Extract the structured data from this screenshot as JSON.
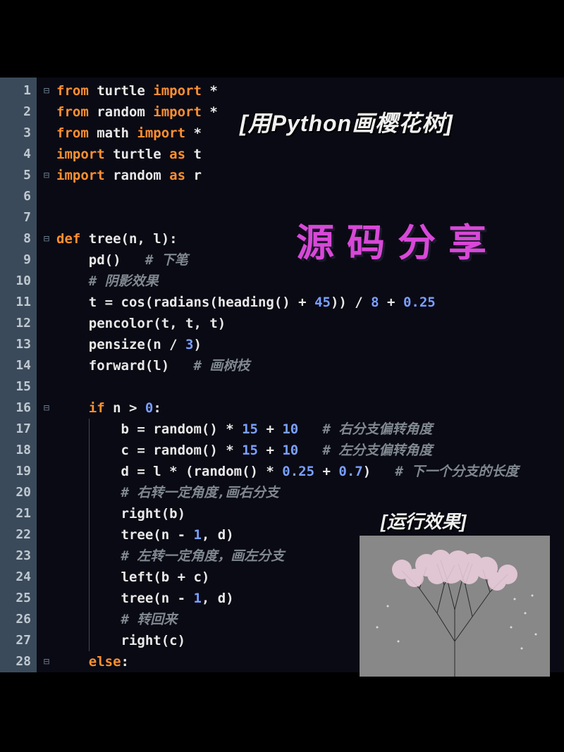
{
  "overlays": {
    "title": "[用Python画樱花树]",
    "subtitle": "源码分享",
    "result_label": "[运行效果]"
  },
  "code": {
    "lines": [
      {
        "n": 1,
        "fold": "⊟",
        "tokens": [
          [
            "kw",
            "from"
          ],
          [
            "id",
            " turtle "
          ],
          [
            "kw",
            "import"
          ],
          [
            "op",
            " *"
          ]
        ]
      },
      {
        "n": 2,
        "fold": "",
        "tokens": [
          [
            "kw",
            "from"
          ],
          [
            "id",
            " random "
          ],
          [
            "kw",
            "import"
          ],
          [
            "op",
            " *"
          ]
        ]
      },
      {
        "n": 3,
        "fold": "",
        "tokens": [
          [
            "kw",
            "from"
          ],
          [
            "id",
            " math "
          ],
          [
            "kw",
            "import"
          ],
          [
            "op",
            " *"
          ]
        ]
      },
      {
        "n": 4,
        "fold": "",
        "tokens": [
          [
            "kw",
            "import"
          ],
          [
            "id",
            " turtle "
          ],
          [
            "kw",
            "as"
          ],
          [
            "id",
            " t"
          ]
        ]
      },
      {
        "n": 5,
        "fold": "⊟",
        "tokens": [
          [
            "kw",
            "import"
          ],
          [
            "id",
            " random "
          ],
          [
            "kw",
            "as"
          ],
          [
            "id",
            " r"
          ]
        ]
      },
      {
        "n": 6,
        "fold": "",
        "tokens": []
      },
      {
        "n": 7,
        "fold": "",
        "tokens": []
      },
      {
        "n": 8,
        "fold": "⊟",
        "tokens": [
          [
            "kw",
            "def"
          ],
          [
            "id",
            " tree(n, l):"
          ]
        ]
      },
      {
        "n": 9,
        "fold": "",
        "indent": 1,
        "tokens": [
          [
            "id",
            "pd()   "
          ],
          [
            "cm",
            "# 下笔"
          ]
        ]
      },
      {
        "n": 10,
        "fold": "",
        "indent": 1,
        "tokens": [
          [
            "cm",
            "# 阴影效果"
          ]
        ]
      },
      {
        "n": 11,
        "fold": "",
        "indent": 1,
        "tokens": [
          [
            "id",
            "t = cos(radians(heading() + "
          ],
          [
            "num",
            "45"
          ],
          [
            "id",
            ")) / "
          ],
          [
            "num",
            "8"
          ],
          [
            "id",
            " + "
          ],
          [
            "num",
            "0.25"
          ]
        ]
      },
      {
        "n": 12,
        "fold": "",
        "indent": 1,
        "tokens": [
          [
            "id",
            "pencolor(t, t, t)"
          ]
        ]
      },
      {
        "n": 13,
        "fold": "",
        "indent": 1,
        "tokens": [
          [
            "id",
            "pensize(n / "
          ],
          [
            "num",
            "3"
          ],
          [
            "id",
            ")"
          ]
        ]
      },
      {
        "n": 14,
        "fold": "",
        "indent": 1,
        "tokens": [
          [
            "id",
            "forward(l)   "
          ],
          [
            "cm",
            "# 画树枝"
          ]
        ]
      },
      {
        "n": 15,
        "fold": "",
        "indent": 1,
        "tokens": []
      },
      {
        "n": 16,
        "fold": "⊟",
        "indent": 1,
        "tokens": [
          [
            "kw",
            "if"
          ],
          [
            "id",
            " n > "
          ],
          [
            "num",
            "0"
          ],
          [
            "id",
            ":"
          ]
        ]
      },
      {
        "n": 17,
        "fold": "",
        "indent": 2,
        "tokens": [
          [
            "id",
            "b = random() * "
          ],
          [
            "num",
            "15"
          ],
          [
            "id",
            " + "
          ],
          [
            "num",
            "10"
          ],
          [
            "id",
            "   "
          ],
          [
            "cm",
            "# 右分支偏转角度"
          ]
        ]
      },
      {
        "n": 18,
        "fold": "",
        "indent": 2,
        "tokens": [
          [
            "id",
            "c = random() * "
          ],
          [
            "num",
            "15"
          ],
          [
            "id",
            " + "
          ],
          [
            "num",
            "10"
          ],
          [
            "id",
            "   "
          ],
          [
            "cm",
            "# 左分支偏转角度"
          ]
        ]
      },
      {
        "n": 19,
        "fold": "",
        "indent": 2,
        "tokens": [
          [
            "id",
            "d = l * (random() * "
          ],
          [
            "num",
            "0.25"
          ],
          [
            "id",
            " + "
          ],
          [
            "num",
            "0.7"
          ],
          [
            "id",
            ")   "
          ],
          [
            "cm",
            "# 下一个分支的长度"
          ]
        ]
      },
      {
        "n": 20,
        "fold": "",
        "indent": 2,
        "tokens": [
          [
            "cm",
            "# 右转一定角度,画右分支"
          ]
        ]
      },
      {
        "n": 21,
        "fold": "",
        "indent": 2,
        "tokens": [
          [
            "id",
            "right(b)"
          ]
        ]
      },
      {
        "n": 22,
        "fold": "",
        "indent": 2,
        "tokens": [
          [
            "id",
            "tree(n - "
          ],
          [
            "num",
            "1"
          ],
          [
            "id",
            ", d)"
          ]
        ]
      },
      {
        "n": 23,
        "fold": "",
        "indent": 2,
        "tokens": [
          [
            "cm",
            "# 左转一定角度，画左分支"
          ]
        ]
      },
      {
        "n": 24,
        "fold": "",
        "indent": 2,
        "tokens": [
          [
            "id",
            "left(b + c)"
          ]
        ]
      },
      {
        "n": 25,
        "fold": "",
        "indent": 2,
        "tokens": [
          [
            "id",
            "tree(n - "
          ],
          [
            "num",
            "1"
          ],
          [
            "id",
            ", d)"
          ]
        ]
      },
      {
        "n": 26,
        "fold": "",
        "indent": 2,
        "tokens": [
          [
            "cm",
            "# 转回来"
          ]
        ]
      },
      {
        "n": 27,
        "fold": "",
        "indent": 2,
        "tokens": [
          [
            "id",
            "right(c)"
          ]
        ]
      },
      {
        "n": 28,
        "fold": "⊟",
        "indent": 1,
        "tokens": [
          [
            "kw",
            "else"
          ],
          [
            "id",
            ":"
          ]
        ]
      }
    ]
  }
}
